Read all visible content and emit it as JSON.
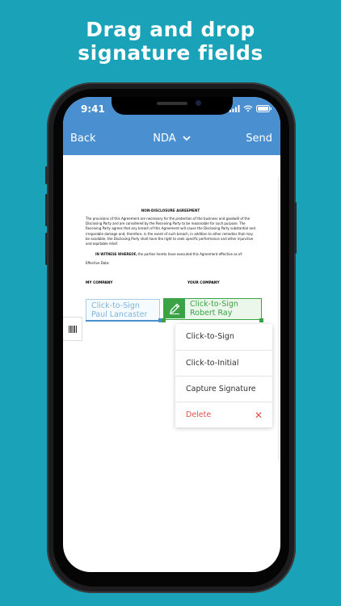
{
  "headline": {
    "line1": "Drag and drop",
    "line2": "signature fields"
  },
  "status_bar": {
    "time": "9:41",
    "icons": [
      "signal-icon",
      "wifi-icon",
      "battery-icon"
    ]
  },
  "navbar": {
    "back": "Back",
    "title": "NDA",
    "send": "Send"
  },
  "document": {
    "title": "NON-DISCLOSURE AGREEMENT",
    "paragraph": "The provisions of this Agreement are necessary for the protection of the business and goodwill of the Disclosing Party and are considered by the Receiving Party to be reasonable for such purpose. The Receiving Party agrees that any breach of this Agreement will cause the Disclosing Party substantial and irreparable damage and, therefore, in the event of such breach, in addition to other remedies that may be available, the Disclosing Party shall have the right to seek specific performance and other injunctive and equitable relief.",
    "witness_bold": "IN WITNESS WHEREOF,",
    "witness_rest": " the parties hereto have executed this Agreement effective as of:",
    "effective_date": "Effective Date:",
    "company_left": "MY COMPANY",
    "company_right": "YOUR COMPANY"
  },
  "signature_fields": [
    {
      "line1": "Click-to-Sign",
      "line2": "Paul Lancaster"
    },
    {
      "line1": "Click-to-Sign",
      "line2": "Robert Ray"
    }
  ],
  "context_menu": [
    {
      "label": "Click-to-Sign"
    },
    {
      "label": "Click-to-Initial"
    },
    {
      "label": "Capture Signature"
    },
    {
      "label": "Delete"
    }
  ],
  "colors": {
    "background": "#1aa2b8",
    "navbar": "#4a90d0",
    "sign_green": "#3aa346",
    "sign_blue": "#7fb3d9",
    "delete_red": "#e0504a"
  }
}
